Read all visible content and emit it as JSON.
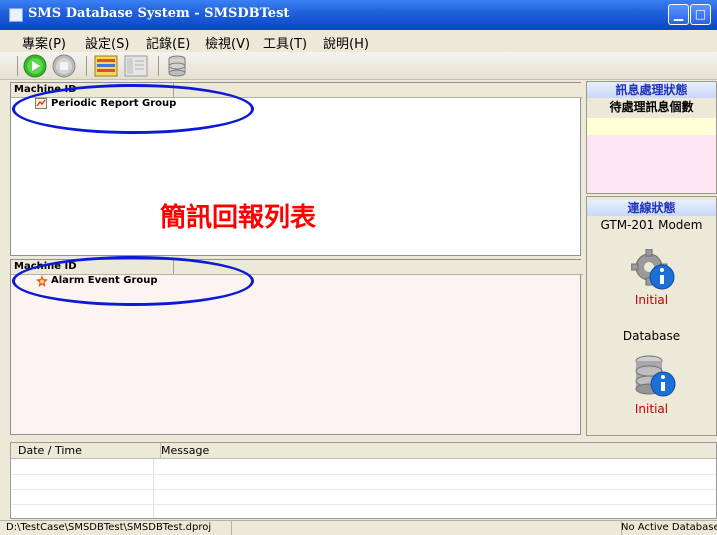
{
  "window": {
    "title": "SMS Database System - SMSDBTest"
  },
  "menu": [
    "專案(P)",
    "設定(S)",
    "記錄(E)",
    "檢視(V)",
    "工具(T)",
    "說明(H)"
  ],
  "toolbar": {
    "icons": [
      "play-icon",
      "stop-icon",
      "report-list-icon",
      "list-view-icon",
      "database-icon"
    ]
  },
  "top_pane": {
    "header": "Machine ID",
    "group": "Periodic Report Group"
  },
  "bottom_pane": {
    "header": "Machine ID",
    "group": "Alarm Event Group"
  },
  "overlay_title": "簡訊回報列表",
  "message_panel": {
    "title": "訊息處理狀態",
    "subtitle": "待處理訊息個數"
  },
  "connection_panel": {
    "title": "連線狀態",
    "modem_label": "GTM-201 Modem",
    "modem_status": "Initial",
    "db_label": "Database",
    "db_status": "Initial"
  },
  "log": {
    "col_datetime": "Date / Time",
    "col_message": "Message"
  },
  "statusbar": {
    "path": "D:\\TestCase\\SMSDBTest\\SMSDBTest.dproj",
    "db_state": "No Active Database"
  },
  "colors": {
    "titlebar": "#1f5fd9",
    "annotation_red": "#ff0000",
    "annotation_blue": "#0b1ad6",
    "status_red": "#c00000"
  }
}
